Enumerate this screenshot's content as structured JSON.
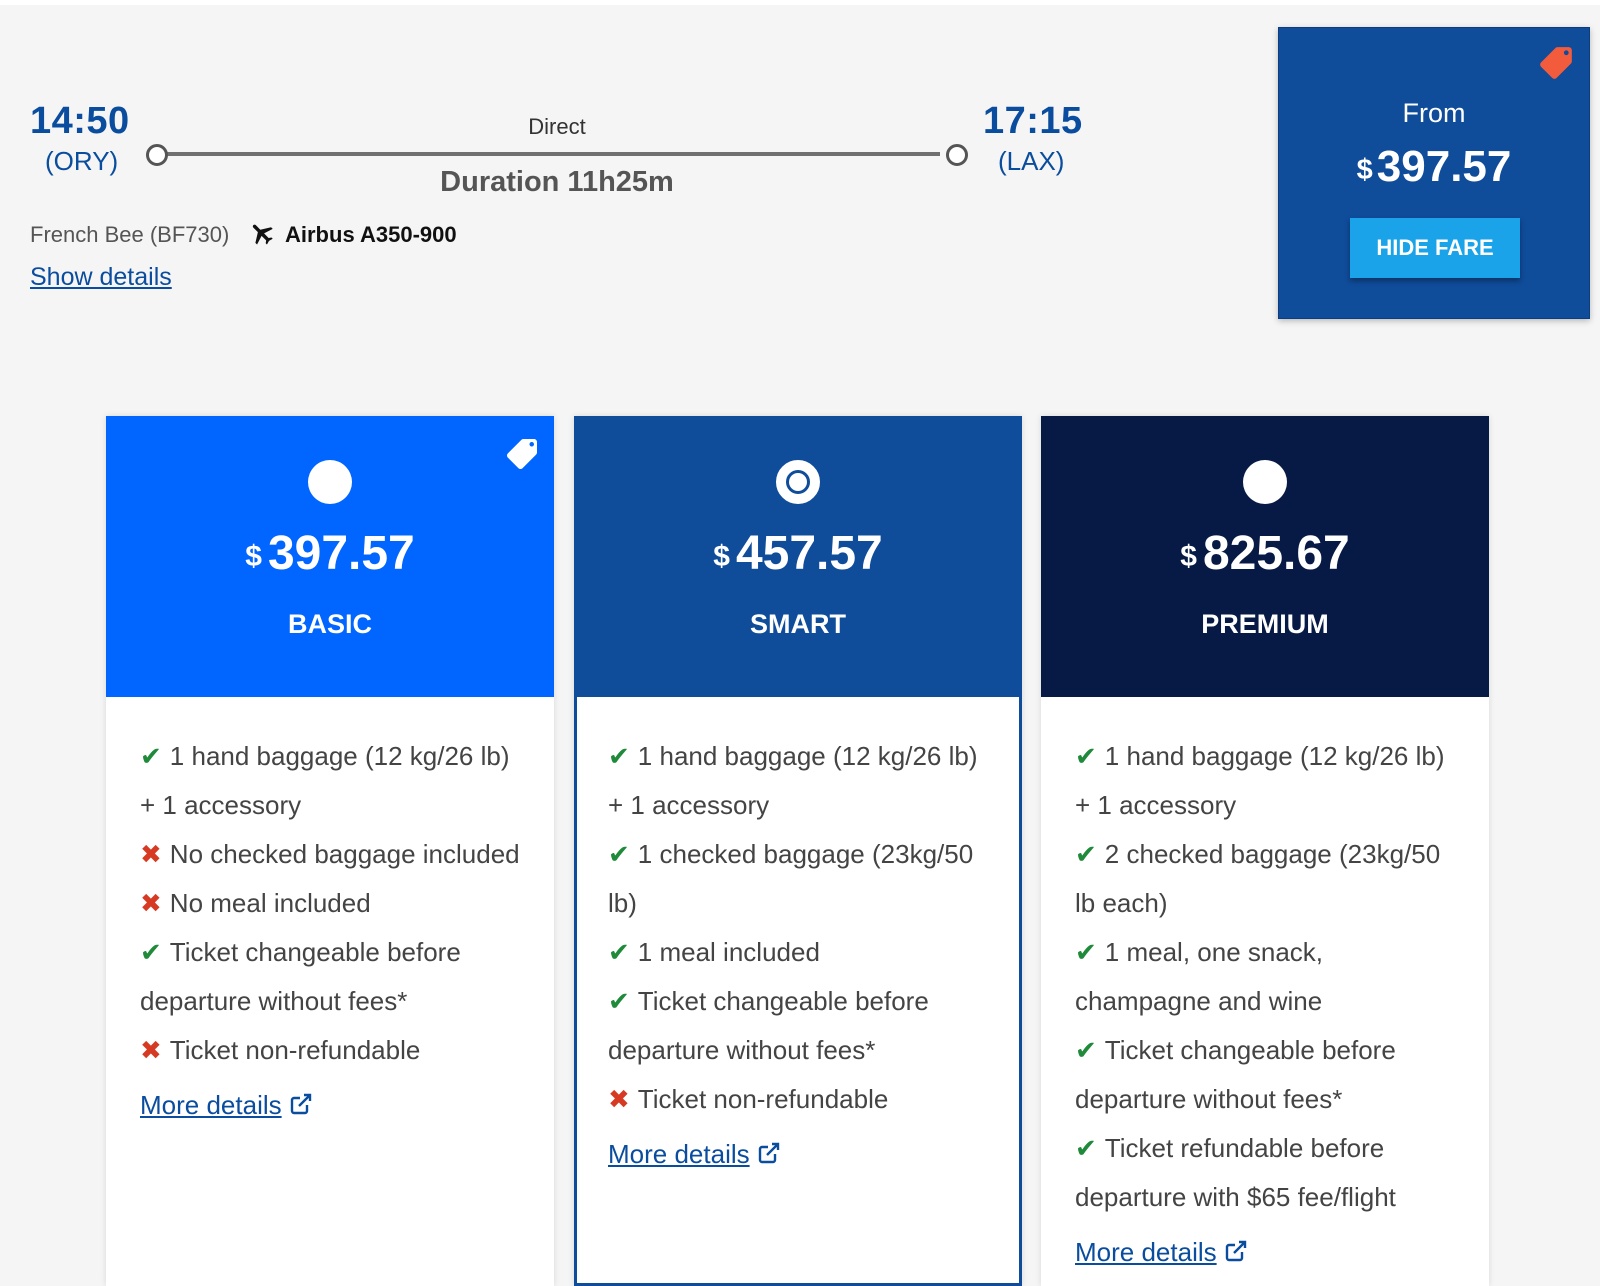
{
  "flight": {
    "departure_time": "14:50",
    "departure_airport": "(ORY)",
    "arrival_time": "17:15",
    "arrival_airport": "(LAX)",
    "stops_label": "Direct",
    "duration": "Duration 11h25m",
    "airline": "French Bee (BF730)",
    "aircraft": "Airbus A350-900",
    "show_details": "Show details"
  },
  "from_box": {
    "label": "From",
    "currency": "$",
    "price": "397.57",
    "button": "HIDE FARE"
  },
  "fares": [
    {
      "name": "BASIC",
      "currency": "$",
      "price": "397.57",
      "selected": false,
      "features": [
        {
          "included": true,
          "text": "1 hand baggage (12 kg/26 lb) + 1 accessory"
        },
        {
          "included": false,
          "text": "No checked baggage included"
        },
        {
          "included": false,
          "text": "No meal included"
        },
        {
          "included": true,
          "text": "Ticket changeable before departure without fees*"
        },
        {
          "included": false,
          "text": "Ticket non-refundable"
        }
      ],
      "more_details": "More details"
    },
    {
      "name": "SMART",
      "currency": "$",
      "price": "457.57",
      "selected": true,
      "features": [
        {
          "included": true,
          "text": "1 hand baggage (12 kg/26 lb) + 1 accessory"
        },
        {
          "included": true,
          "text": "1 checked baggage (23kg/50 lb)"
        },
        {
          "included": true,
          "text": "1 meal included"
        },
        {
          "included": true,
          "text": "Ticket changeable before departure without fees*"
        },
        {
          "included": false,
          "text": "Ticket non-refundable"
        }
      ],
      "more_details": "More details"
    },
    {
      "name": "PREMIUM",
      "currency": "$",
      "price": "825.67",
      "selected": false,
      "features": [
        {
          "included": true,
          "text": "1 hand baggage (12 kg/26 lb) + 1 accessory"
        },
        {
          "included": true,
          "text": "2 checked baggage (23kg/50 lb each)"
        },
        {
          "included": true,
          "text": "1 meal, one snack, champagne and wine"
        },
        {
          "included": true,
          "text": "Ticket changeable before departure without fees*"
        },
        {
          "included": true,
          "text": "Ticket refundable before departure with $65 fee/flight"
        }
      ],
      "more_details": "More details"
    }
  ],
  "colors": {
    "basic_header": "#0066ff",
    "smart_header": "#0f4c9a",
    "premium_header": "#061a45",
    "accent_blue": "#0a4d9e",
    "button_cyan": "#1aa3e8",
    "tag_orange": "#f25c3c",
    "check_green": "#1f8a3a",
    "cross_red": "#d63a22"
  },
  "icons": {
    "plane": "plane-icon",
    "tag": "price-tag-icon",
    "external": "external-link-icon",
    "check": "check-icon",
    "cross": "cross-icon"
  }
}
